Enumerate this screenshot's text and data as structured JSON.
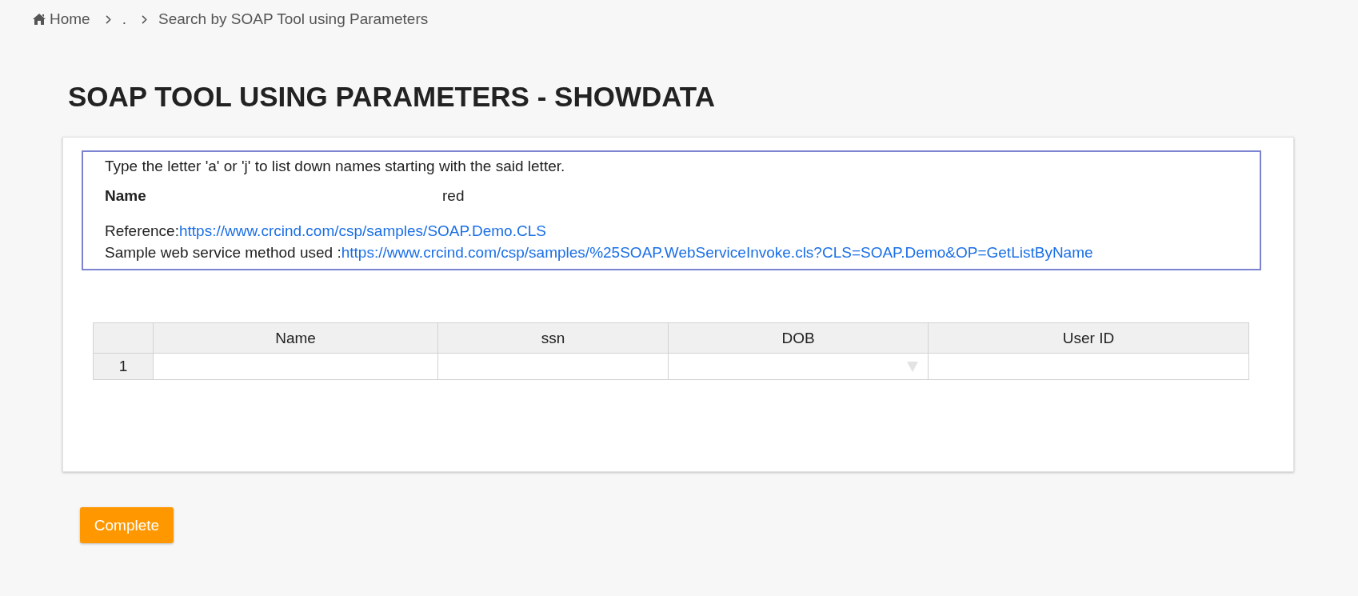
{
  "breadcrumb": [
    {
      "label": "Home",
      "kind": "home"
    },
    {
      "label": ".",
      "kind": "link"
    },
    {
      "label": "Search by SOAP Tool using Parameters",
      "kind": "current"
    }
  ],
  "page_title": "SOAP TOOL USING PARAMETERS - SHOWDATA",
  "form": {
    "instruction": "Type the letter 'a' or 'j' to list down names starting with the said letter.",
    "name_field": {
      "label": "Name",
      "value": "red"
    },
    "links": [
      {
        "label": "Reference:",
        "url": "https://www.crcind.com/csp/samples/SOAP.Demo.CLS"
      },
      {
        "label": "Sample web service method used :",
        "url": "https://www.crcind.com/csp/samples/%25SOAP.WebServiceInvoke.cls?CLS=SOAP.Demo&OP=GetListByName"
      }
    ]
  },
  "table": {
    "columns": [
      {
        "label": "Name",
        "kind": "text"
      },
      {
        "label": "ssn",
        "kind": "text"
      },
      {
        "label": "DOB",
        "kind": "dropdown"
      },
      {
        "label": "User ID",
        "kind": "text"
      }
    ],
    "rows": [
      {
        "number": "1"
      }
    ]
  },
  "complete_button": {
    "label": "Complete"
  }
}
